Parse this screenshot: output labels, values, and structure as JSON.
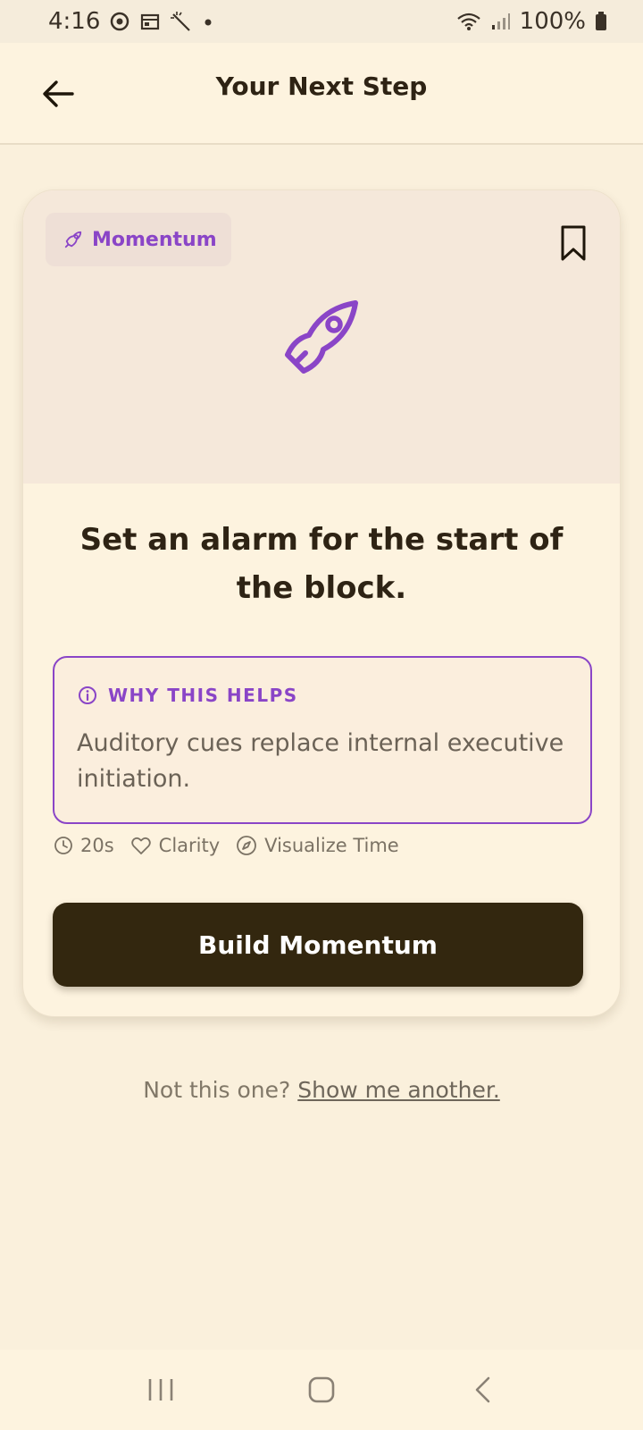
{
  "status_bar": {
    "time": "4:16",
    "battery": "100%"
  },
  "header": {
    "title": "Your Next Step",
    "back_icon": "arrow-left-icon"
  },
  "card": {
    "tag": {
      "label": "Momentum",
      "icon": "rocket-icon",
      "color": "#8A45C7"
    },
    "bookmark_icon": "bookmark-icon",
    "hero_icon": "rocket-icon",
    "title": "Set an alarm for the start of the block.",
    "why": {
      "heading": "WHY THIS HELPS",
      "icon": "info-icon",
      "text": "Auditory cues replace internal executive initiation."
    },
    "meta": [
      {
        "icon": "clock-icon",
        "label": "20s"
      },
      {
        "icon": "heart-icon",
        "label": "Clarity"
      },
      {
        "icon": "compass-icon",
        "label": "Visualize Time"
      }
    ],
    "action_label": "Build Momentum"
  },
  "footer": {
    "prompt": "Not this one?",
    "link": "Show me another."
  },
  "colors": {
    "background": "#FAF0DC",
    "accent": "#8A45C7",
    "button": "#33270F"
  }
}
